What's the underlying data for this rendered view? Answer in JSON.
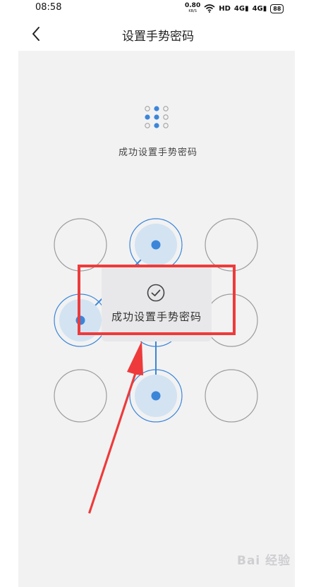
{
  "status_bar": {
    "time": "08:58",
    "net_speed_value": "0.80",
    "net_speed_unit": "KB/S",
    "hd_label": "HD",
    "signal_1": "4G",
    "signal_2": "4G",
    "battery": "88"
  },
  "header": {
    "title": "设置手势密码",
    "back_icon": "chevron-left-icon"
  },
  "hint": {
    "text": "成功设置手势密码",
    "icon": "pattern-preview-icon"
  },
  "gesture_grid": {
    "rows": 3,
    "cols": 3,
    "selected_nodes": [
      2,
      4,
      5,
      8
    ],
    "accent_color": "#3b86d8",
    "fill_color": "#d3e3f2",
    "ring_color": "#9c9c9c"
  },
  "toast": {
    "text": "成功设置手势密码",
    "icon": "check-circle-icon"
  },
  "annotation": {
    "color": "#ee3a3a"
  },
  "watermark": {
    "text": "Bai 经验"
  }
}
